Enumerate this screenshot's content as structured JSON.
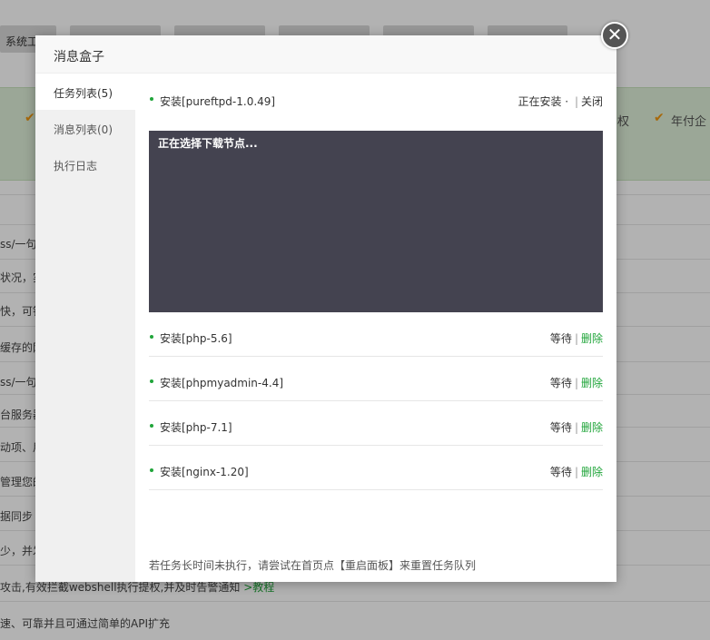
{
  "background": {
    "tabs": [
      "系统工",
      "",
      "",
      "",
      "",
      ""
    ],
    "features": [
      "权",
      "年付企"
    ],
    "rows": [
      "ss/一句",
      "状况，实",
      "快，可针",
      "缓存的网",
      "ss/一句",
      "台服务器",
      "动项、用",
      "管理您的",
      "据同步",
      "少，并发",
      "攻击,有效拦截webshell执行提权,并及时告警通知",
      "速、可靠并且可通过简单的API扩充"
    ],
    "row_link": ">教程"
  },
  "modal": {
    "title": "消息盒子",
    "close_glyph": "✕",
    "sidebar": [
      {
        "label": "任务列表(5)",
        "active": true
      },
      {
        "label": "消息列表(0)",
        "active": false
      },
      {
        "label": "执行日志",
        "active": false
      }
    ],
    "current_task": {
      "name": "安装[pureftpd-1.0.49]",
      "status": "正在安装 ·",
      "action": "关闭",
      "console_text": "正在选择下载节点..."
    },
    "queued_tasks": [
      {
        "name": "安装[php-5.6]",
        "status": "等待",
        "action": "删除"
      },
      {
        "name": "安装[phpmyadmin-4.4]",
        "status": "等待",
        "action": "删除"
      },
      {
        "name": "安装[php-7.1]",
        "status": "等待",
        "action": "删除"
      },
      {
        "name": "安装[nginx-1.20]",
        "status": "等待",
        "action": "删除"
      }
    ],
    "footer_note": "若任务长时间未执行，请尝试在首页点【重启面板】来重置任务队列"
  },
  "colors": {
    "accent": "#20a53a",
    "console_bg": "#444350",
    "overlay": "rgba(0,0,0,0.30)",
    "check": "#f0960f"
  }
}
